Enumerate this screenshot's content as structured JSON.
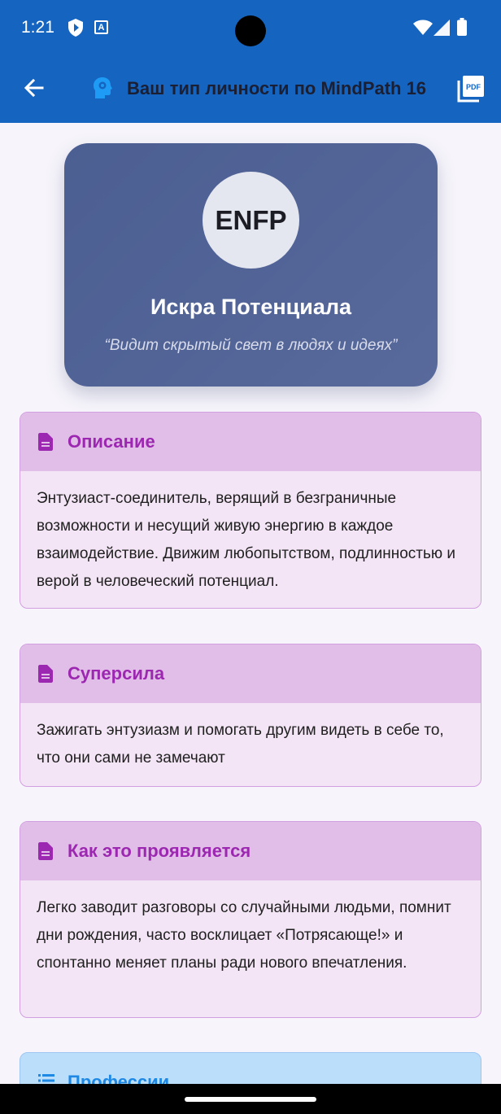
{
  "status_bar": {
    "time": "1:21",
    "icons": [
      "shield-play-icon",
      "a-box-icon",
      "wifi-icon",
      "signal-icon",
      "battery-icon"
    ]
  },
  "app_bar": {
    "title": "Ваш тип личности по MindPath 16",
    "icons": [
      "back-arrow-icon",
      "brain-gear-icon",
      "pdf-icon"
    ],
    "color": "#1565c0"
  },
  "hero": {
    "type_code": "ENFP",
    "type_name": "Искра Потенциала",
    "quote": "“Видит скрытый свет в людях и идеях”"
  },
  "sections": [
    {
      "title": "Описание",
      "icon": "document-icon",
      "body": "Энтузиаст-соединитель, верящий в безграничные возможности и несущий живую энергию в каждое взаимодействие. Движим любопытством, подлинностью и верой в человеческий потенциал."
    },
    {
      "title": "Суперсила",
      "icon": "document-icon",
      "body": "Зажигать энтузиазм и помогать другим видеть в себе то, что они сами не замечают"
    },
    {
      "title": "Как это проявляется",
      "icon": "document-icon",
      "body": "Легко заводит разговоры со случайными людьми, помнит дни рождения, часто восклицает «Потрясающе!» и спонтанно меняет планы ради нового впечатления."
    },
    {
      "title": "Профессии",
      "icon": "list-icon"
    }
  ],
  "colors": {
    "section_accent": "#9c27b0",
    "section_header_bg": "#e1bee7",
    "section_body_bg": "#f3e5f5",
    "professions_accent": "#1e88e5"
  }
}
